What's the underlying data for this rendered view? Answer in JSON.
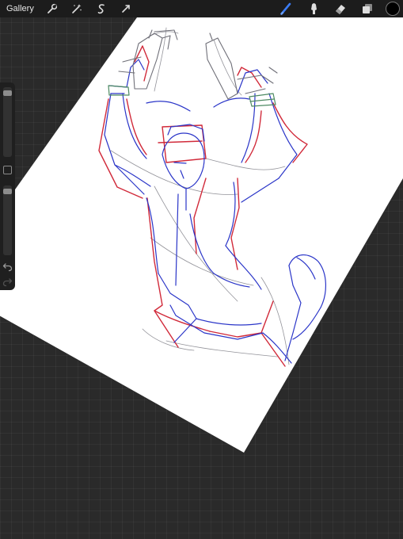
{
  "toolbar": {
    "gallery_label": "Gallery",
    "left_icons": [
      "wrench-icon",
      "magic-wand-icon",
      "selection-icon",
      "transform-icon"
    ],
    "right_icons": [
      "brush-icon",
      "smudge-icon",
      "eraser-icon",
      "layers-icon"
    ],
    "active_tool": "brush-icon",
    "active_tool_color": "#3b7cf4",
    "current_color": "#000000"
  },
  "sidebar": {
    "brush_size_level": 0.95,
    "opacity_level": 0.95,
    "controls": [
      "brush-size-slider",
      "modify-button",
      "opacity-slider",
      "undo-button",
      "redo-button"
    ]
  },
  "canvas": {
    "paper_color": "#ffffff",
    "background_color": "#2a2a2a",
    "sketch_colors": [
      "#2a35c8",
      "#d12a3a",
      "#4d8a62",
      "#6f6f78"
    ]
  }
}
